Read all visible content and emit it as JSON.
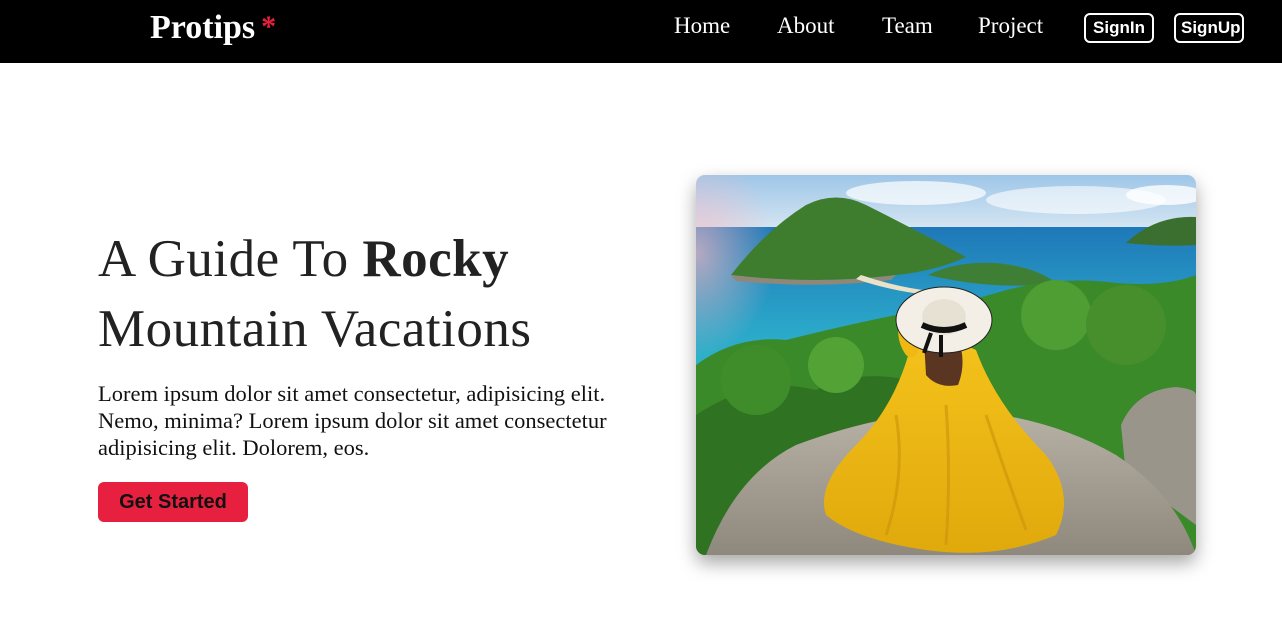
{
  "navbar": {
    "brand": "Protips",
    "brand_mark": "*",
    "links": [
      "Home",
      "About",
      "Team",
      "Project"
    ],
    "signin_label": "SignIn",
    "signup_label": "SignUp"
  },
  "hero": {
    "title_part1": "A Guide To ",
    "title_bold": "Rocky",
    "title_part2": "Mountain Vacations",
    "description": "Lorem ipsum dolor sit amet consectetur, adipisicing elit. Nemo, minima? Lorem ipsum dolor sit amet consectetur adipisicing elit. Dolorem, eos.",
    "cta_label": "Get Started",
    "image_subject": "woman in yellow dress and sun hat overlooking tropical island bay"
  },
  "colors": {
    "navbar_bg": "#000000",
    "accent": "#e8203f",
    "text": "#222222"
  }
}
